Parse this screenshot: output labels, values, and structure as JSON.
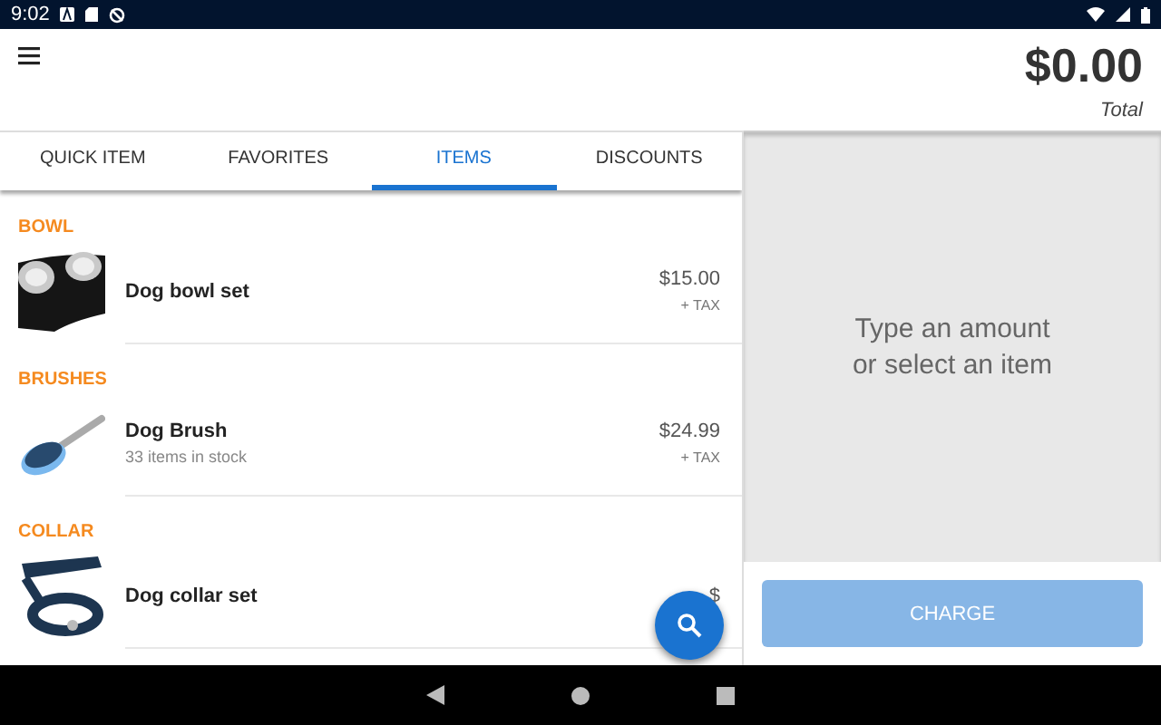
{
  "status_bar": {
    "time": "9:02"
  },
  "header": {
    "total": "$0.00",
    "total_label": "Total"
  },
  "tabs": [
    {
      "label": "QUICK ITEM",
      "selected": false
    },
    {
      "label": "FAVORITES",
      "selected": false
    },
    {
      "label": "ITEMS",
      "selected": true
    },
    {
      "label": "DISCOUNTS",
      "selected": false
    }
  ],
  "sections": [
    {
      "title": "BOWL",
      "items": [
        {
          "name": "Dog bowl set",
          "price": "$15.00",
          "tax": "+ TAX",
          "kind": "picture"
        }
      ]
    },
    {
      "title": "BRUSHES",
      "items": [
        {
          "name": "Dog Brush",
          "stock": "33 items in stock",
          "price": "$24.99",
          "tax": "+ TAX",
          "kind": "picture"
        }
      ]
    },
    {
      "title": "COLLAR",
      "items": [
        {
          "name": "Dog collar set",
          "price": "$",
          "kind": "picture"
        }
      ]
    }
  ],
  "amount_prompt": "Type an amount\nor select an item",
  "charge_button": {
    "label": "CHARGE",
    "disabled": true
  }
}
